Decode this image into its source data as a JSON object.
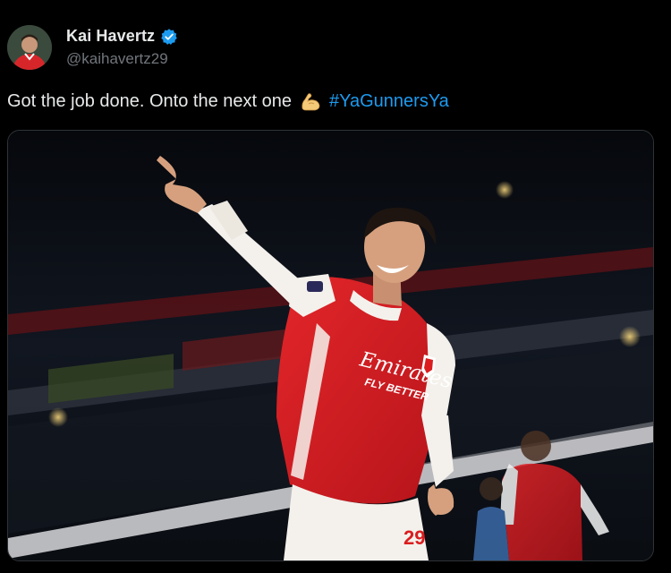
{
  "tweet": {
    "author": {
      "display_name": "Kai Havertz",
      "handle": "@kaihavertz29",
      "verified": true,
      "avatar_icon": "profile-photo"
    },
    "text": "Got the job done. Onto the next one",
    "emoji": "💪",
    "hashtag": "#YaGunnersYa",
    "media": {
      "type": "photo",
      "shirt_sponsor": "Emirates",
      "shirt_tagline": "FLY BETTER",
      "shirt_number": "29"
    }
  },
  "colors": {
    "background": "#000000",
    "text": "#e7e9ea",
    "secondary": "#71767b",
    "link": "#1d9bf0",
    "verified": "#1d9bf0",
    "arsenal_red": "#db1d1f"
  }
}
